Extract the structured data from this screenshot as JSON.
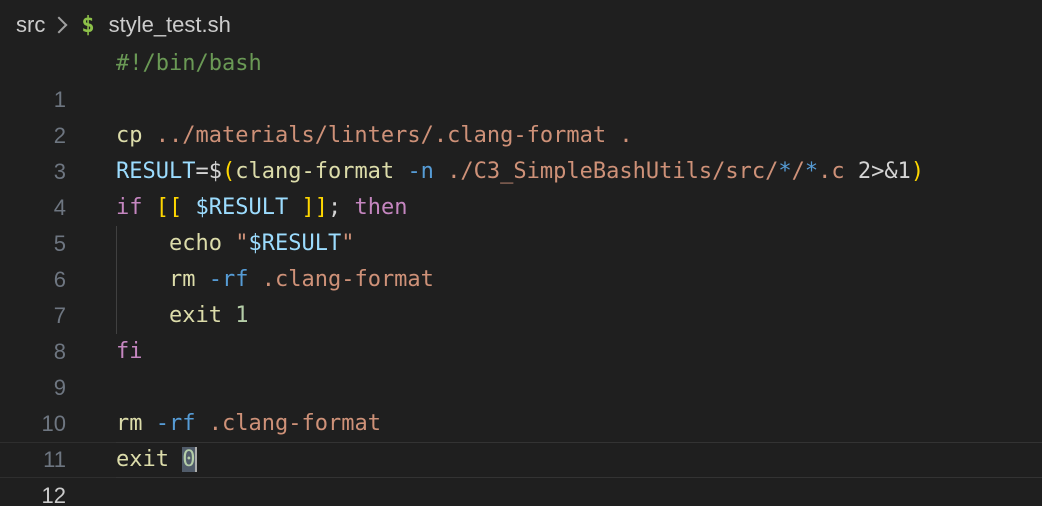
{
  "breadcrumb": {
    "folder": "src",
    "file_icon": "$",
    "file": "style_test.sh"
  },
  "editor": {
    "language": "bash",
    "current_line": 12,
    "lines": [
      {
        "num": "1"
      },
      {
        "num": "2"
      },
      {
        "num": "3"
      },
      {
        "num": "4"
      },
      {
        "num": "5"
      },
      {
        "num": "6"
      },
      {
        "num": "7"
      },
      {
        "num": "8"
      },
      {
        "num": "9"
      },
      {
        "num": "10"
      },
      {
        "num": "11"
      },
      {
        "num": "12"
      }
    ],
    "tokens": {
      "l1": [
        "#!/bin/bash"
      ],
      "l3": [
        "cp",
        " ",
        "../materials/linters/.clang-format",
        " ."
      ],
      "l4": [
        "RESULT",
        "=$",
        "(",
        "clang-format",
        " ",
        "-n",
        " ",
        "./C3_SimpleBashUtils/src/",
        "*",
        "/",
        "*",
        ".c",
        " 2>&1",
        ")"
      ],
      "l5": [
        "if",
        " ",
        "[[",
        " ",
        "$RESULT",
        " ",
        "]]",
        "; ",
        "then"
      ],
      "l6": [
        "    ",
        "echo",
        " ",
        "\"",
        "$RESULT",
        "\""
      ],
      "l7": [
        "    ",
        "rm",
        " ",
        "-rf",
        " ",
        ".clang-format"
      ],
      "l8": [
        "    ",
        "exit",
        " ",
        "1"
      ],
      "l9": [
        "fi"
      ],
      "l11": [
        "rm",
        " ",
        "-rf",
        " ",
        ".clang-format"
      ],
      "l12": [
        "exit",
        " ",
        "0"
      ]
    }
  },
  "colors": {
    "background": "#1f1f1f",
    "comment": "#6a9955",
    "command": "#dcdcaa",
    "string": "#ce9178",
    "variable": "#9cdcfe",
    "keyword": "#c586c0",
    "operator": "#569cd6",
    "number": "#b5cea8",
    "bracket": "#ffd700"
  }
}
